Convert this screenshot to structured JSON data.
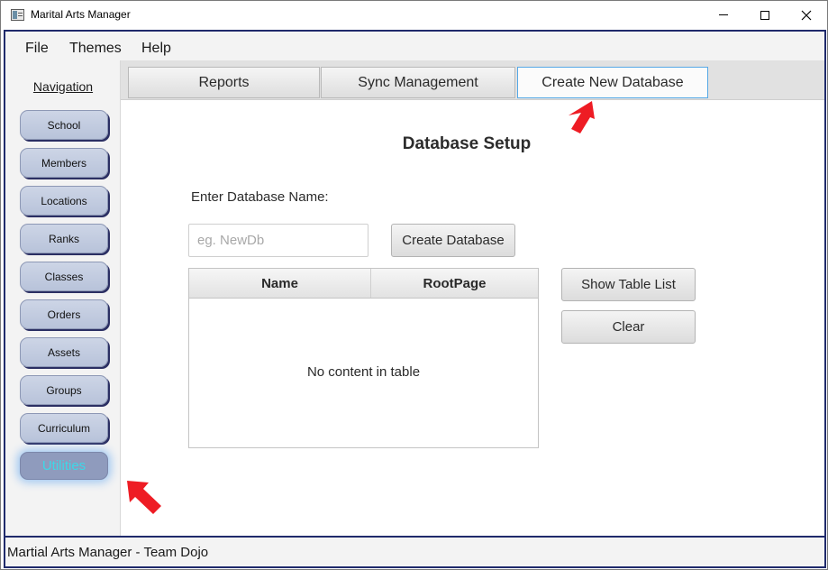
{
  "window": {
    "title": "Marital Arts Manager"
  },
  "menu": {
    "file": "File",
    "themes": "Themes",
    "help": "Help"
  },
  "sidebar": {
    "title": "Navigation",
    "items": [
      {
        "label": "School"
      },
      {
        "label": "Members"
      },
      {
        "label": "Locations"
      },
      {
        "label": "Ranks"
      },
      {
        "label": "Classes"
      },
      {
        "label": "Orders"
      },
      {
        "label": "Assets"
      },
      {
        "label": "Groups"
      },
      {
        "label": "Curriculum"
      },
      {
        "label": "Utilities",
        "active": true
      }
    ]
  },
  "tabs": [
    {
      "label": "Reports"
    },
    {
      "label": "Sync Management"
    },
    {
      "label": "Create New Database",
      "selected": true
    }
  ],
  "content": {
    "heading": "Database Setup",
    "db_label": "Enter Database Name:",
    "db_input_value": "",
    "db_input_placeholder": "eg. NewDb",
    "create_button": "Create Database",
    "show_table_button": "Show Table List",
    "clear_button": "Clear",
    "table": {
      "columns": [
        "Name",
        "RootPage"
      ],
      "rows": [],
      "empty_text": "No content in table"
    }
  },
  "status": {
    "text": "Martial Arts Manager - Team Dojo"
  },
  "colors": {
    "frame_border": "#1f2a6b",
    "nav_button": "#c4cde2",
    "active_nav": "#8f9bbd",
    "active_nav_text": "#3dd8e8",
    "selected_tab_border": "#55a8e6",
    "annotation_arrow": "#ee1c24"
  },
  "icons": {
    "app": "app-window-icon",
    "minimize": "minimize-icon",
    "maximize": "maximize-icon",
    "close": "close-icon",
    "annotation": "red-arrow-icon"
  }
}
